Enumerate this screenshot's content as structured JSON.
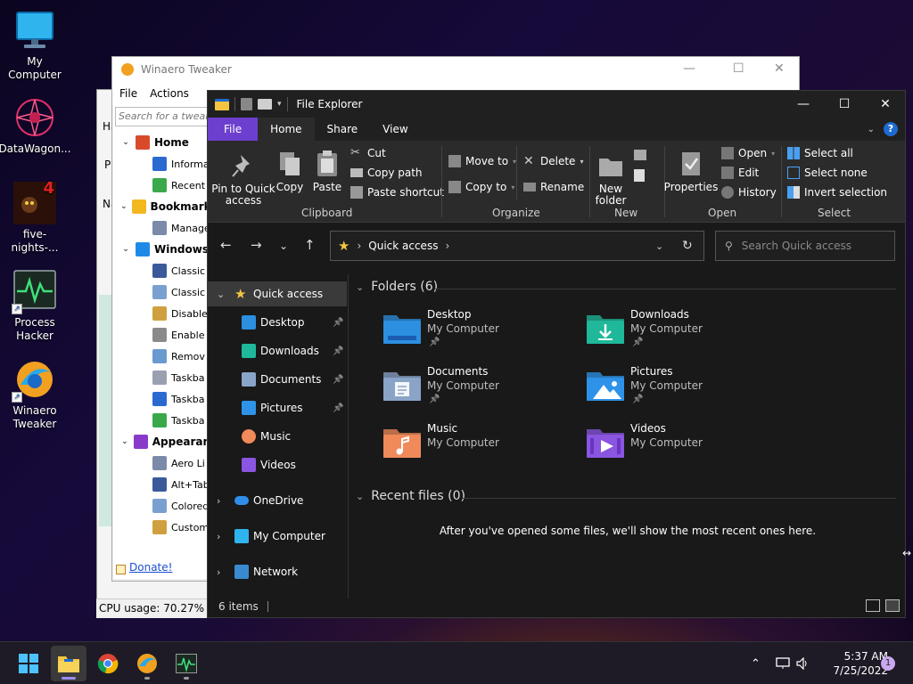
{
  "desktop": {
    "icons": [
      {
        "label": "My Computer"
      },
      {
        "label": "DataWagon..."
      },
      {
        "label": "five-nights-..."
      },
      {
        "label": "Process Hacker"
      },
      {
        "label": "Winaero Tweaker"
      }
    ],
    "fnaf_badge": "4"
  },
  "winaero": {
    "title": "Winaero Tweaker",
    "menu": [
      "File",
      "Actions"
    ],
    "search_placeholder": "Search for a tweak...",
    "tree": [
      {
        "label": "Home",
        "group": true
      },
      {
        "label": "Informa"
      },
      {
        "label": "Recent"
      },
      {
        "label": "Bookmark",
        "group": true
      },
      {
        "label": "Manage"
      },
      {
        "label": "Windows",
        "group": true
      },
      {
        "label": "Classic"
      },
      {
        "label": "Classic"
      },
      {
        "label": "Disable"
      },
      {
        "label": "Enable"
      },
      {
        "label": "Remov"
      },
      {
        "label": "Taskba"
      },
      {
        "label": "Taskba"
      },
      {
        "label": "Taskba"
      },
      {
        "label": "Appearan",
        "group": true
      },
      {
        "label": "Aero Li"
      },
      {
        "label": "Alt+Tab"
      },
      {
        "label": "Colored"
      },
      {
        "label": "Custom"
      }
    ],
    "donate": "Donate!"
  },
  "process_hacker": {
    "cpu_usage": "CPU usage: 70.27%",
    "row_labels": [
      "Ha",
      "Pr",
      "Na"
    ]
  },
  "explorer": {
    "title": "File Explorer",
    "tabs": {
      "file": "File",
      "home": "Home",
      "share": "Share",
      "view": "View"
    },
    "ribbon": {
      "pin": "Pin to Quick access",
      "copy": "Copy",
      "paste": "Paste",
      "cut": "Cut",
      "copy_path": "Copy path",
      "paste_shortcut": "Paste shortcut",
      "clipboard": "Clipboard",
      "move_to": "Move to",
      "copy_to": "Copy to",
      "delete": "Delete",
      "rename": "Rename",
      "organize": "Organize",
      "new_folder": "New folder",
      "new": "New",
      "properties": "Properties",
      "open": "Open",
      "edit": "Edit",
      "history": "History",
      "open_group": "Open",
      "select_all": "Select all",
      "select_none": "Select none",
      "invert_selection": "Invert selection",
      "select_group": "Select"
    },
    "address": "Quick access",
    "search_placeholder": "Search Quick access",
    "nav": [
      {
        "label": "Quick access"
      },
      {
        "label": "Desktop"
      },
      {
        "label": "Downloads"
      },
      {
        "label": "Documents"
      },
      {
        "label": "Pictures"
      },
      {
        "label": "Music"
      },
      {
        "label": "Videos"
      },
      {
        "label": "OneDrive"
      },
      {
        "label": "My Computer"
      },
      {
        "label": "Network"
      }
    ],
    "folders_header": "Folders (6)",
    "folders": [
      {
        "name": "Desktop",
        "location": "My Computer",
        "pinned": true,
        "color": "#2c8fe0"
      },
      {
        "name": "Downloads",
        "location": "My Computer",
        "pinned": true,
        "color": "#1fb89a"
      },
      {
        "name": "Documents",
        "location": "My Computer",
        "pinned": true,
        "color": "#8aa4c8"
      },
      {
        "name": "Pictures",
        "location": "My Computer",
        "pinned": true,
        "color": "#2e93e8"
      },
      {
        "name": "Music",
        "location": "My Computer",
        "pinned": false,
        "color": "#f08a5a"
      },
      {
        "name": "Videos",
        "location": "My Computer",
        "pinned": false,
        "color": "#8a55e0"
      }
    ],
    "recent_header": "Recent files (0)",
    "recent_empty": "After you've opened some files, we'll show the most recent ones here.",
    "status": "6 items"
  },
  "taskbar": {
    "time": "5:37 AM",
    "date": "7/25/2022",
    "notification_count": "1"
  },
  "colors": {
    "accent_file_tab": "#6c3fcf",
    "explorer_bg": "#191919",
    "ribbon_bg": "#2b2b2b"
  }
}
